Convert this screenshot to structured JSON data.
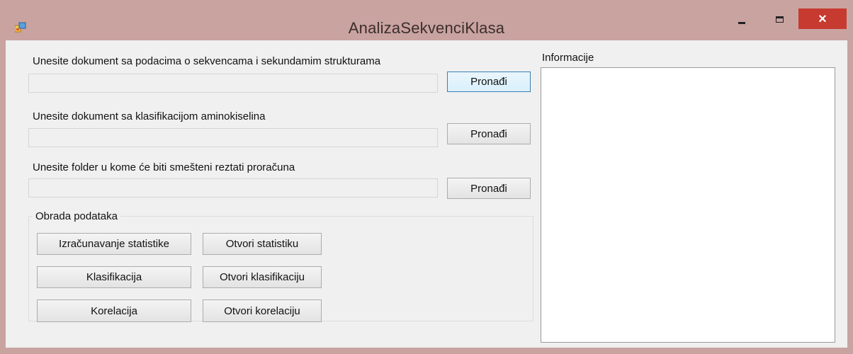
{
  "window": {
    "title": "AnalizaSekvenciKlasa",
    "close_symbol": "×"
  },
  "inputs": [
    {
      "label": "Unesite dokument sa podacima o sekvencama i sekundamim strukturama",
      "value": "",
      "button": "Pronađi"
    },
    {
      "label": "Unesite dokument sa klasifikacijom aminokiselina",
      "value": "",
      "button": "Pronađi"
    },
    {
      "label": "Unesite folder u kome će biti smešteni reztati proračuna",
      "value": "",
      "button": "Pronađi"
    }
  ],
  "processing": {
    "title": "Obrada podataka",
    "buttons": {
      "calc_stats": "Izračunavanje statistike",
      "open_stats": "Otvori statistiku",
      "classify": "Klasifikacija",
      "open_classify": "Otvori klasifikaciju",
      "correlate": "Korelacija",
      "open_correlate": "Otvori korelaciju"
    }
  },
  "info": {
    "label": "Informacije",
    "content": ""
  },
  "icons": {
    "app": "app-window-icon",
    "minimize": "minimize-icon",
    "maximize": "maximize-icon",
    "close": "close-icon"
  }
}
